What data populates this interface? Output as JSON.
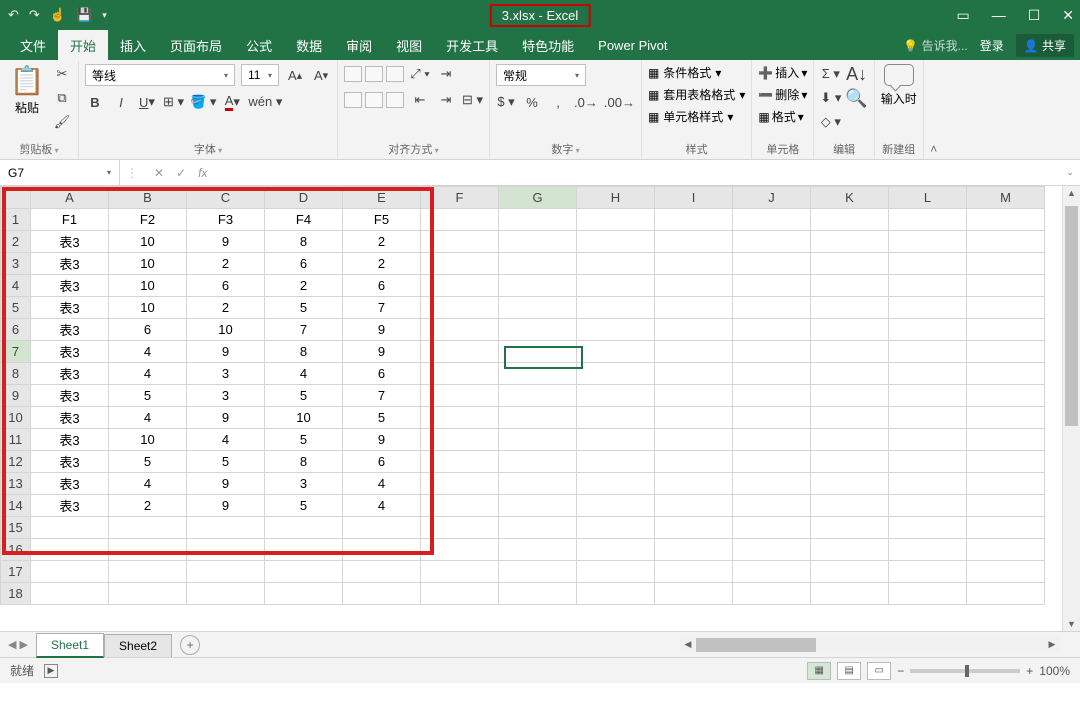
{
  "titlebar": {
    "title": "3.xlsx - Excel",
    "qat_icons": [
      "undo-icon",
      "redo-icon",
      "touch-icon",
      "save-icon",
      "customize-icon"
    ]
  },
  "menubar": {
    "tabs": [
      "文件",
      "开始",
      "插入",
      "页面布局",
      "公式",
      "数据",
      "审阅",
      "视图",
      "开发工具",
      "特色功能",
      "Power Pivot"
    ],
    "active_index": 1,
    "tell_me": "告诉我...",
    "login": "登录",
    "share": "共享"
  },
  "ribbon": {
    "clipboard": {
      "paste": "粘贴",
      "label": "剪贴板"
    },
    "font": {
      "name": "等线",
      "size": "11",
      "label": "字体"
    },
    "alignment": {
      "label": "对齐方式"
    },
    "number": {
      "format": "常规",
      "label": "数字"
    },
    "styles": {
      "cond_fmt": "条件格式",
      "table_fmt": "套用表格格式",
      "cell_style": "单元格样式",
      "label": "样式"
    },
    "cells": {
      "insert": "插入",
      "delete": "删除",
      "format": "格式",
      "label": "单元格"
    },
    "editing": {
      "label": "编辑"
    },
    "newgroup": {
      "btn": "输入时",
      "label": "新建组"
    }
  },
  "namebox": {
    "cell_ref": "G7",
    "fx": "fx"
  },
  "grid": {
    "columns": [
      "A",
      "B",
      "C",
      "D",
      "E",
      "F",
      "G",
      "H",
      "I",
      "J",
      "K",
      "L",
      "M"
    ],
    "rows": [
      {
        "n": "1",
        "cells": [
          "F1",
          "F2",
          "F3",
          "F4",
          "F5"
        ]
      },
      {
        "n": "2",
        "cells": [
          "表3",
          "10",
          "9",
          "8",
          "2"
        ]
      },
      {
        "n": "3",
        "cells": [
          "表3",
          "10",
          "2",
          "6",
          "2"
        ]
      },
      {
        "n": "4",
        "cells": [
          "表3",
          "10",
          "6",
          "2",
          "6"
        ]
      },
      {
        "n": "5",
        "cells": [
          "表3",
          "10",
          "2",
          "5",
          "7"
        ]
      },
      {
        "n": "6",
        "cells": [
          "表3",
          "6",
          "10",
          "7",
          "9"
        ]
      },
      {
        "n": "7",
        "cells": [
          "表3",
          "4",
          "9",
          "8",
          "9"
        ]
      },
      {
        "n": "8",
        "cells": [
          "表3",
          "4",
          "3",
          "4",
          "6"
        ]
      },
      {
        "n": "9",
        "cells": [
          "表3",
          "5",
          "3",
          "5",
          "7"
        ]
      },
      {
        "n": "10",
        "cells": [
          "表3",
          "4",
          "9",
          "10",
          "5"
        ]
      },
      {
        "n": "11",
        "cells": [
          "表3",
          "10",
          "4",
          "5",
          "9"
        ]
      },
      {
        "n": "12",
        "cells": [
          "表3",
          "5",
          "5",
          "8",
          "6"
        ]
      },
      {
        "n": "13",
        "cells": [
          "表3",
          "4",
          "9",
          "3",
          "4"
        ]
      },
      {
        "n": "14",
        "cells": [
          "表3",
          "2",
          "9",
          "5",
          "4"
        ]
      },
      {
        "n": "15",
        "cells": []
      },
      {
        "n": "16",
        "cells": []
      },
      {
        "n": "17",
        "cells": []
      },
      {
        "n": "18",
        "cells": []
      }
    ],
    "active_cell": "G7"
  },
  "tabs": {
    "sheet1": "Sheet1",
    "sheet2": "Sheet2"
  },
  "statusbar": {
    "ready": "就绪",
    "zoom": "100%"
  }
}
